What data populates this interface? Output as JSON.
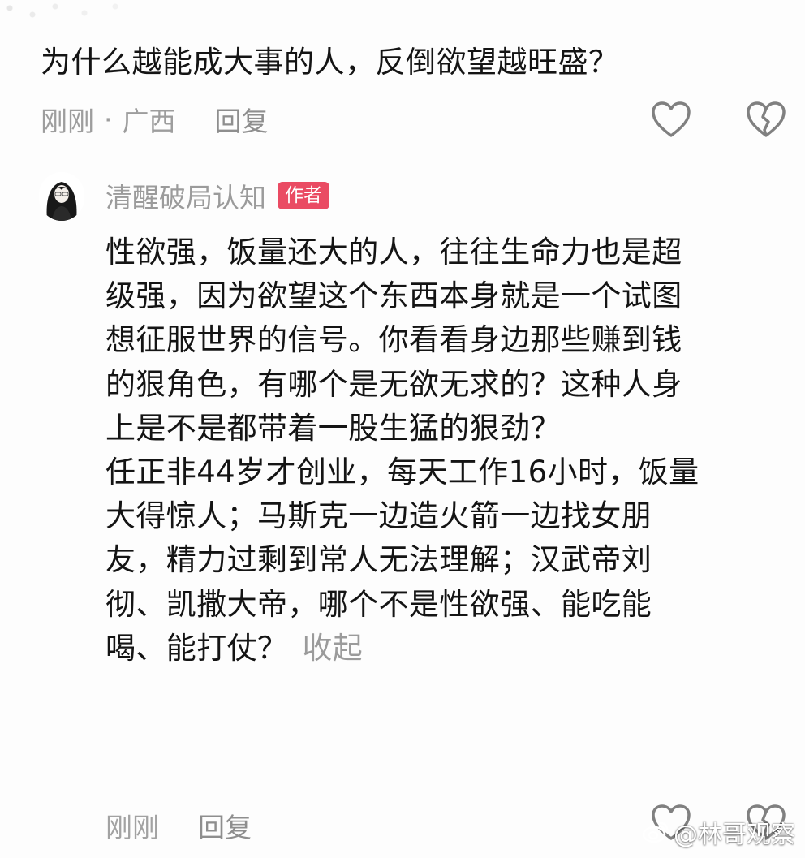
{
  "colors": {
    "text": "#141414",
    "meta": "#9d9d9d",
    "badge": "#ea4b63",
    "icon": "#808080"
  },
  "question": {
    "text": "为什么越能成大事的人，反倒欲望越旺盛？",
    "time": "刚刚",
    "separator": "·",
    "location": "广西",
    "reply_label": "回复",
    "icons": [
      "heart-outline-icon",
      "broken-heart-icon"
    ]
  },
  "reply": {
    "author": "清醒破局认知",
    "badge": "作者",
    "lines": [
      "性欲强，饭量还大的人，往往生命力也是超",
      "级强，因为欲望这个东西本身就是一个试图",
      "想征服世界的信号。你看看身边那些赚到钱",
      "的狠角色，有哪个是无欲无求的？这种人身",
      "上是不是都带着一股生猛的狠劲？",
      "任正非44岁才创业，每天工作16小时，饭量",
      "大得惊人；马斯克一边造火箭一边找女朋",
      "友，精力过剩到常人无法理解；汉武帝刘",
      "彻、凯撒大帝，哪个不是性欲强、能吃能",
      "喝、能打仗？"
    ],
    "collapse_label": "收起",
    "time": "刚刚",
    "reply_label": "回复",
    "icons": [
      "heart-outline-icon",
      "broken-heart-icon"
    ]
  },
  "watermark": {
    "text": "@林哥观察",
    "icon": "weibo-icon"
  }
}
